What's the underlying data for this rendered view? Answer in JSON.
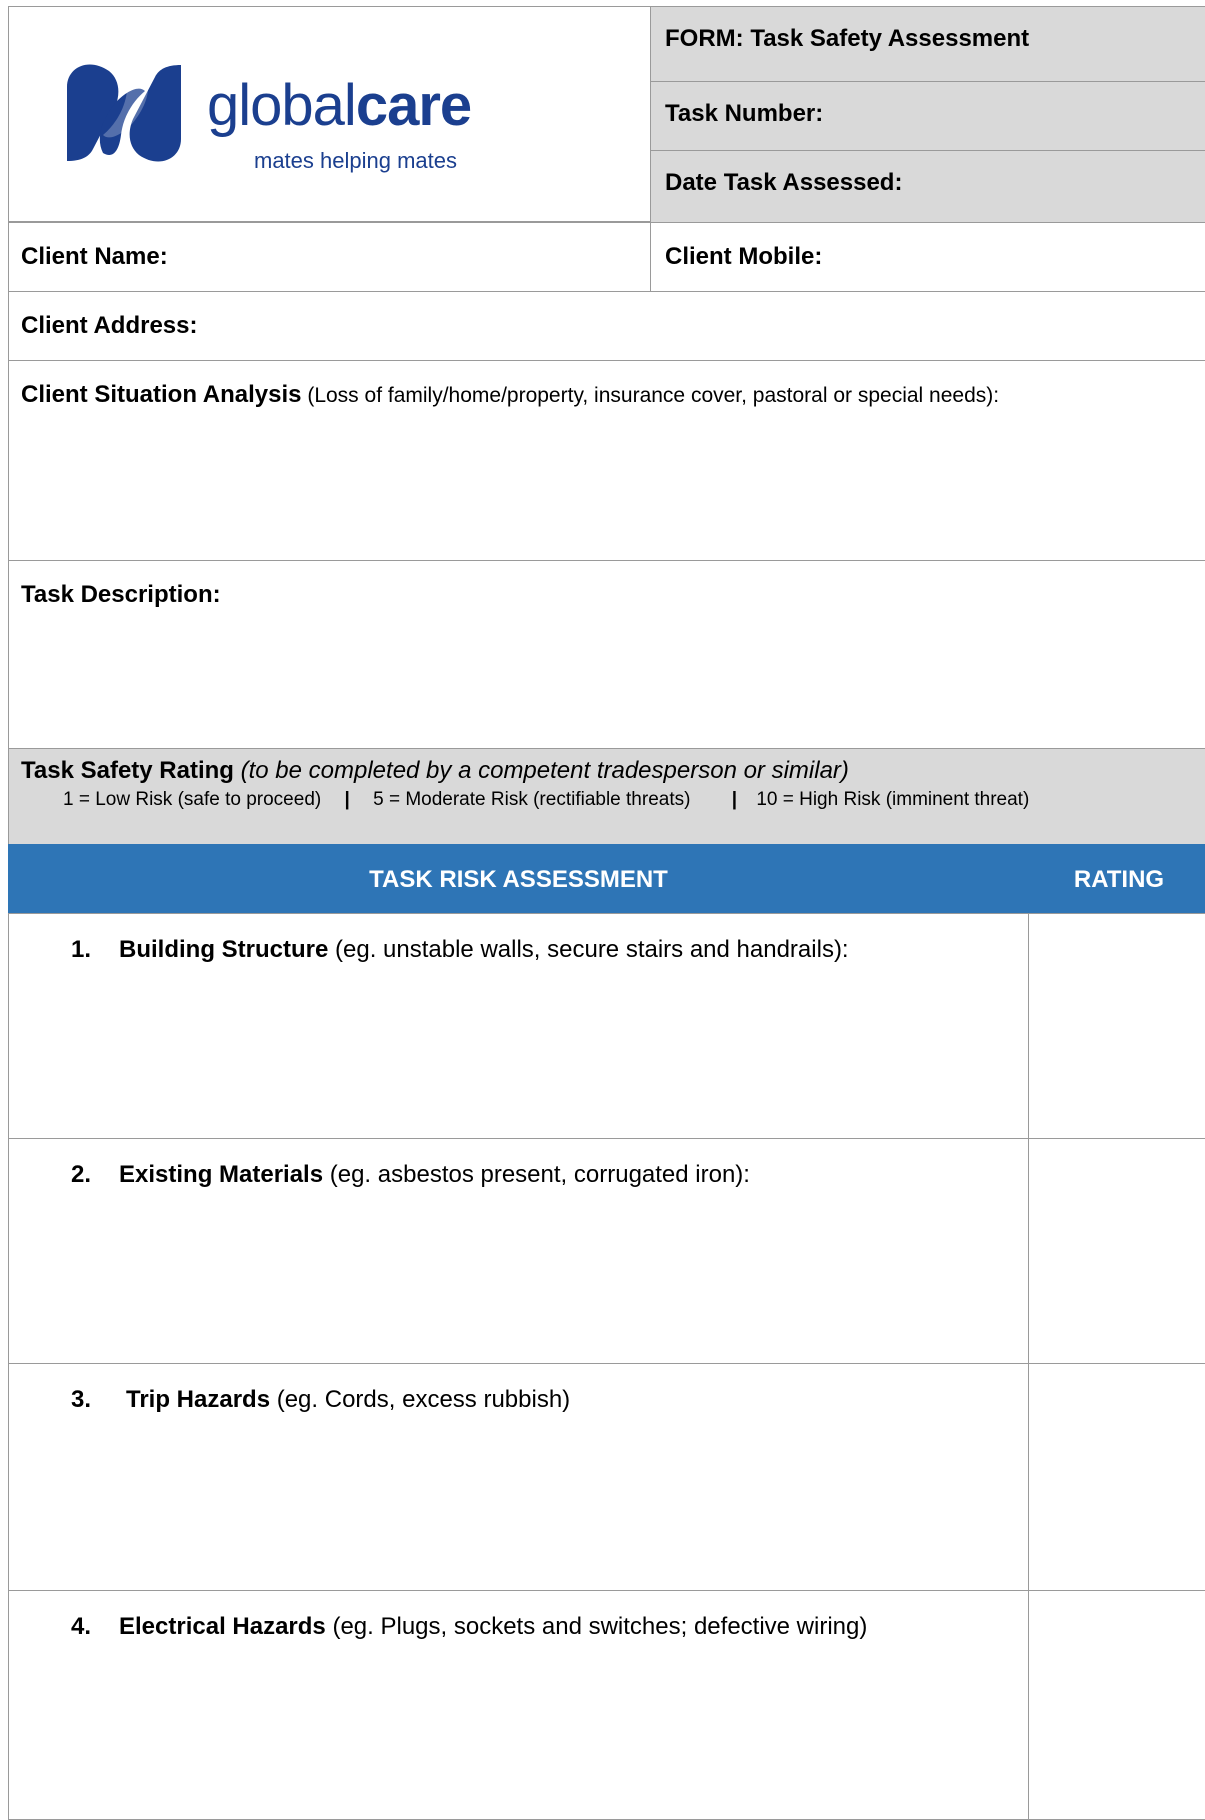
{
  "logo": {
    "brand_light": "global",
    "brand_bold": "care",
    "tagline": "mates helping mates",
    "brand_color": "#1b3f8f"
  },
  "header": {
    "form_title": "FORM: Task Safety Assessment",
    "task_number_label": "Task Number:",
    "date_assessed_label": "Date Task Assessed:"
  },
  "client": {
    "name_label": "Client Name:",
    "mobile_label": "Client Mobile:",
    "address_label": "Client Address:",
    "situation_label": "Client Situation Analysis",
    "situation_note": " (Loss of family/home/property, insurance cover, pastoral or special needs):"
  },
  "task": {
    "description_label": "Task Description:",
    "rating_label": "Task Safety Rating",
    "rating_note": " (to be completed by a competent tradesperson or similar)",
    "scale": [
      "1 = Low Risk (safe to proceed)",
      "5 = Moderate Risk (rectifiable threats)",
      "10 = High Risk (imminent threat)"
    ],
    "separator": "|"
  },
  "risk_table": {
    "header_assessment": "TASK RISK ASSESSMENT",
    "header_rating": "RATING",
    "header_color": "#2e75b6",
    "items": [
      {
        "num": "1.",
        "name": "Building Structure",
        "desc": " (eg. unstable walls, secure stairs and handrails):"
      },
      {
        "num": "2.",
        "name": "Existing Materials",
        "desc": " (eg. asbestos present, corrugated iron):"
      },
      {
        "num": "3.",
        "name": "Trip Hazards",
        "desc": " (eg. Cords, excess rubbish)"
      },
      {
        "num": "4.",
        "name": "Electrical Hazards",
        "desc": " (eg. Plugs, sockets and switches; defective wiring)"
      }
    ]
  }
}
